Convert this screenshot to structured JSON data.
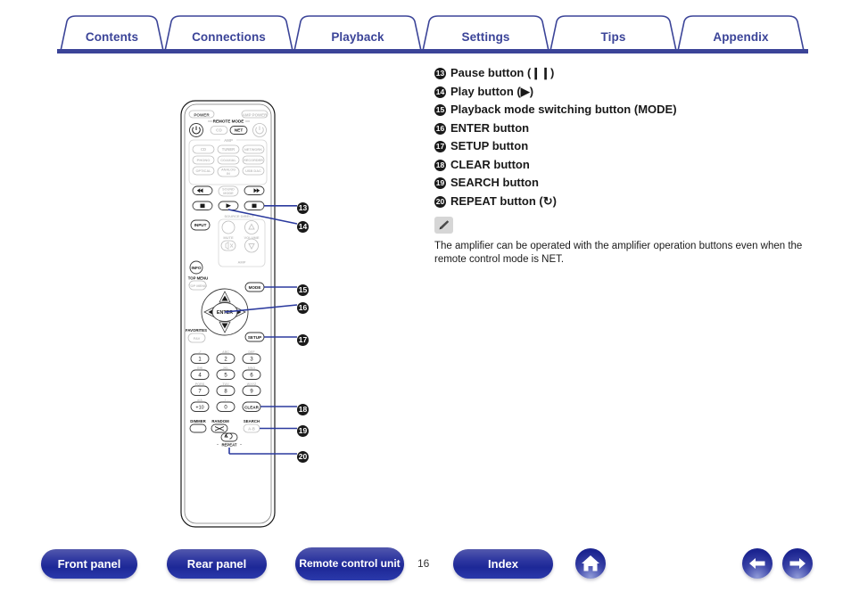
{
  "header": {
    "tabs": [
      {
        "label": "Contents"
      },
      {
        "label": "Connections"
      },
      {
        "label": "Playback"
      },
      {
        "label": "Settings"
      },
      {
        "label": "Tips"
      },
      {
        "label": "Appendix"
      }
    ],
    "accent_color": "#3b4498"
  },
  "main": {
    "callouts": [
      {
        "number": "13",
        "text": "Pause button (❙❙)"
      },
      {
        "number": "14",
        "text": "Play button (▶)"
      },
      {
        "number": "15",
        "text": "Playback mode switching button (MODE)"
      },
      {
        "number": "16",
        "text": "ENTER button"
      },
      {
        "number": "17",
        "text": "SETUP button"
      },
      {
        "number": "18",
        "text": "CLEAR button"
      },
      {
        "number": "19",
        "text": "SEARCH button"
      },
      {
        "number": "20",
        "text": "REPEAT button (↻)"
      }
    ],
    "note": {
      "icon": "pencil-icon",
      "text": "The amplifier can be operated with the amplifier operation buttons even when the remote control mode is NET."
    }
  },
  "remote": {
    "title": "remote-control-unit-diagram",
    "labels": {
      "power": "POWER",
      "remote_mode": "REMOTE MODE",
      "amp_power": "AMP POWER",
      "mode_cd": "CD",
      "mode_net": "NET",
      "amp_group": "AMP",
      "src_cd": "CD",
      "src_tuner": "TUNER",
      "src_network": "NETWORK",
      "src_phono": "PHONO",
      "src_coaxial": "COAXIAL",
      "src_recorder": "RECORDER",
      "src_optical": "OPTICAL",
      "src_analog_in": "ANALOG IN",
      "src_usb_dac": "USB DAC",
      "sound_mode": "SOUND MODE",
      "input": "INPUT",
      "info": "INFO",
      "mute": "MUTE",
      "volume": "VOLUME",
      "amp_small": "AMP",
      "top_menu": "TOP MENU",
      "top_menu_btn": "TOP MENU",
      "favorites": "FAVORITES",
      "favorites_btn": "FAV",
      "mode": "MODE",
      "enter": "ENTER",
      "setup": "SETUP",
      "clear": "CLEAR",
      "dimmer": "DIMMER",
      "random": "RANDOM",
      "repeat": "REPEAT",
      "search": "SEARCH",
      "search_btn": "A-B",
      "key_plus10": "+10",
      "key_0": "0",
      "key_1": "1",
      "key_2": "2",
      "key_3": "3",
      "key_4": "4",
      "key_5": "5",
      "key_6": "6",
      "key_7": "7",
      "key_8": "8",
      "key_9": "9",
      "alt_1": "-/'",
      "alt_2": "ABC",
      "alt_3": "DEF",
      "alt_4": "GHI",
      "alt_5": "JKL",
      "alt_6": "MNO",
      "alt_7": "PQRS",
      "alt_8": "TUV",
      "alt_9": "WXYZ",
      "alt_plus10": "a/A",
      "alt_0": "_/→"
    },
    "callout_numbers": [
      "13",
      "14",
      "15",
      "16",
      "17",
      "18",
      "19",
      "20"
    ]
  },
  "footer": {
    "buttons": [
      {
        "label": "Front panel",
        "two_line": false
      },
      {
        "label": "Rear panel",
        "two_line": false
      },
      {
        "label": "Remote control unit",
        "two_line": true
      },
      {
        "label": "Index",
        "two_line": false
      }
    ],
    "page_number": "16",
    "home_icon": "home-icon",
    "prev_icon": "arrow-left-icon",
    "next_icon": "arrow-right-icon"
  }
}
